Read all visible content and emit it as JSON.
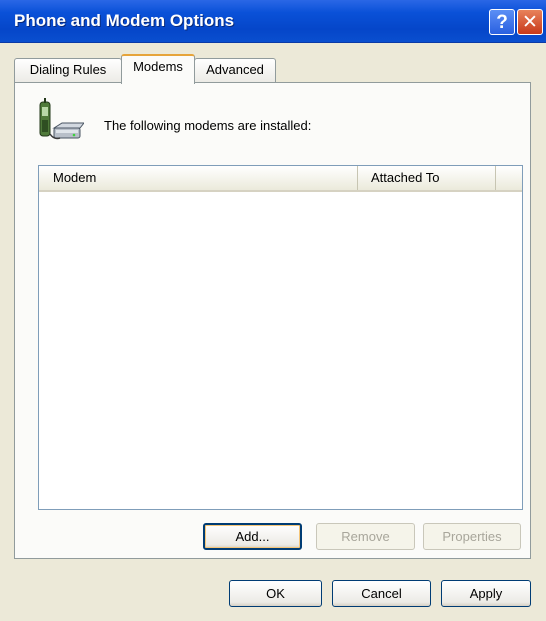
{
  "window": {
    "title": "Phone and Modem Options",
    "help_glyph": "?",
    "close_glyph": "✕"
  },
  "tabs": [
    {
      "label": "Dialing Rules",
      "selected": false
    },
    {
      "label": "Modems",
      "selected": true
    },
    {
      "label": "Advanced",
      "selected": false
    }
  ],
  "modems_page": {
    "intro_text": "The following modems are  installed:",
    "icon": "phone-modem-icon",
    "columns": [
      {
        "label": "Modem"
      },
      {
        "label": "Attached To"
      }
    ],
    "rows": []
  },
  "page_buttons": {
    "add": "Add...",
    "remove": "Remove",
    "properties": "Properties"
  },
  "dialog_buttons": {
    "ok": "OK",
    "cancel": "Cancel",
    "apply": "Apply"
  },
  "colors": {
    "titlebar": "#0a51d8",
    "dialog_bg": "#ece9d8",
    "tab_highlight": "#e6a43a"
  }
}
